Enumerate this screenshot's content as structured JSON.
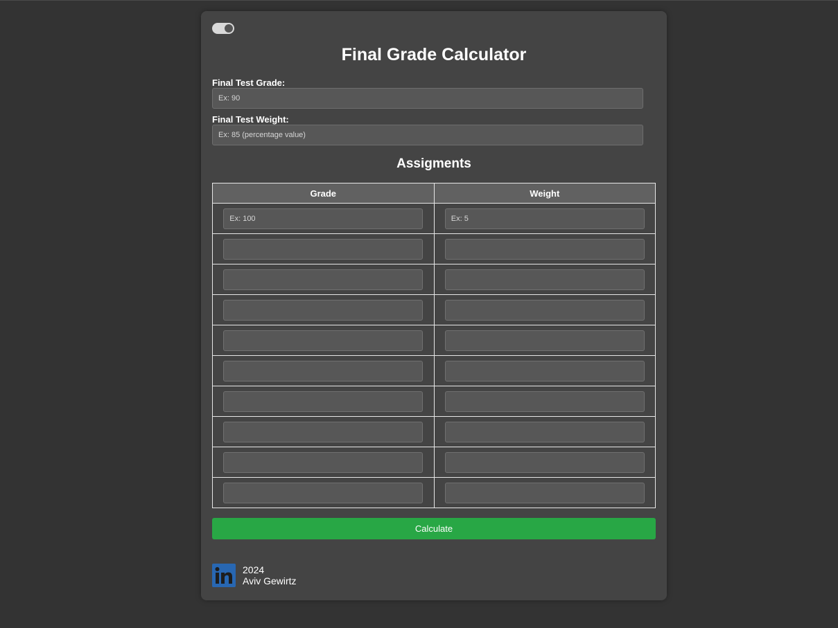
{
  "page": {
    "title": "Final Grade Calculator"
  },
  "final_test": {
    "grade_label": "Final Test Grade:",
    "grade_placeholder": "Ex: 90",
    "weight_label": "Final Test Weight:",
    "weight_placeholder": "Ex: 85 (percentage value)"
  },
  "assignments": {
    "title": "Assigments",
    "columns": [
      "Grade",
      "Weight"
    ],
    "rows": [
      {
        "grade": "",
        "weight": "",
        "grade_placeholder": "Ex: 100",
        "weight_placeholder": "Ex: 5"
      },
      {
        "grade": "",
        "weight": "",
        "grade_placeholder": "",
        "weight_placeholder": ""
      },
      {
        "grade": "",
        "weight": "",
        "grade_placeholder": "",
        "weight_placeholder": ""
      },
      {
        "grade": "",
        "weight": "",
        "grade_placeholder": "",
        "weight_placeholder": ""
      },
      {
        "grade": "",
        "weight": "",
        "grade_placeholder": "",
        "weight_placeholder": ""
      },
      {
        "grade": "",
        "weight": "",
        "grade_placeholder": "",
        "weight_placeholder": ""
      },
      {
        "grade": "",
        "weight": "",
        "grade_placeholder": "",
        "weight_placeholder": ""
      },
      {
        "grade": "",
        "weight": "",
        "grade_placeholder": "",
        "weight_placeholder": ""
      },
      {
        "grade": "",
        "weight": "",
        "grade_placeholder": "",
        "weight_placeholder": ""
      },
      {
        "grade": "",
        "weight": "",
        "grade_placeholder": "",
        "weight_placeholder": ""
      }
    ]
  },
  "calculate_label": "Calculate",
  "footer": {
    "year": "2024",
    "author": "Aviv Gewirtz",
    "icon": "linkedin-icon"
  },
  "theme_toggle": {
    "icon": "theme-toggle",
    "state": "on"
  },
  "colors": {
    "background": "#333333",
    "card": "#444444",
    "accent": "#28a745",
    "linkedin": "#2867b2"
  }
}
